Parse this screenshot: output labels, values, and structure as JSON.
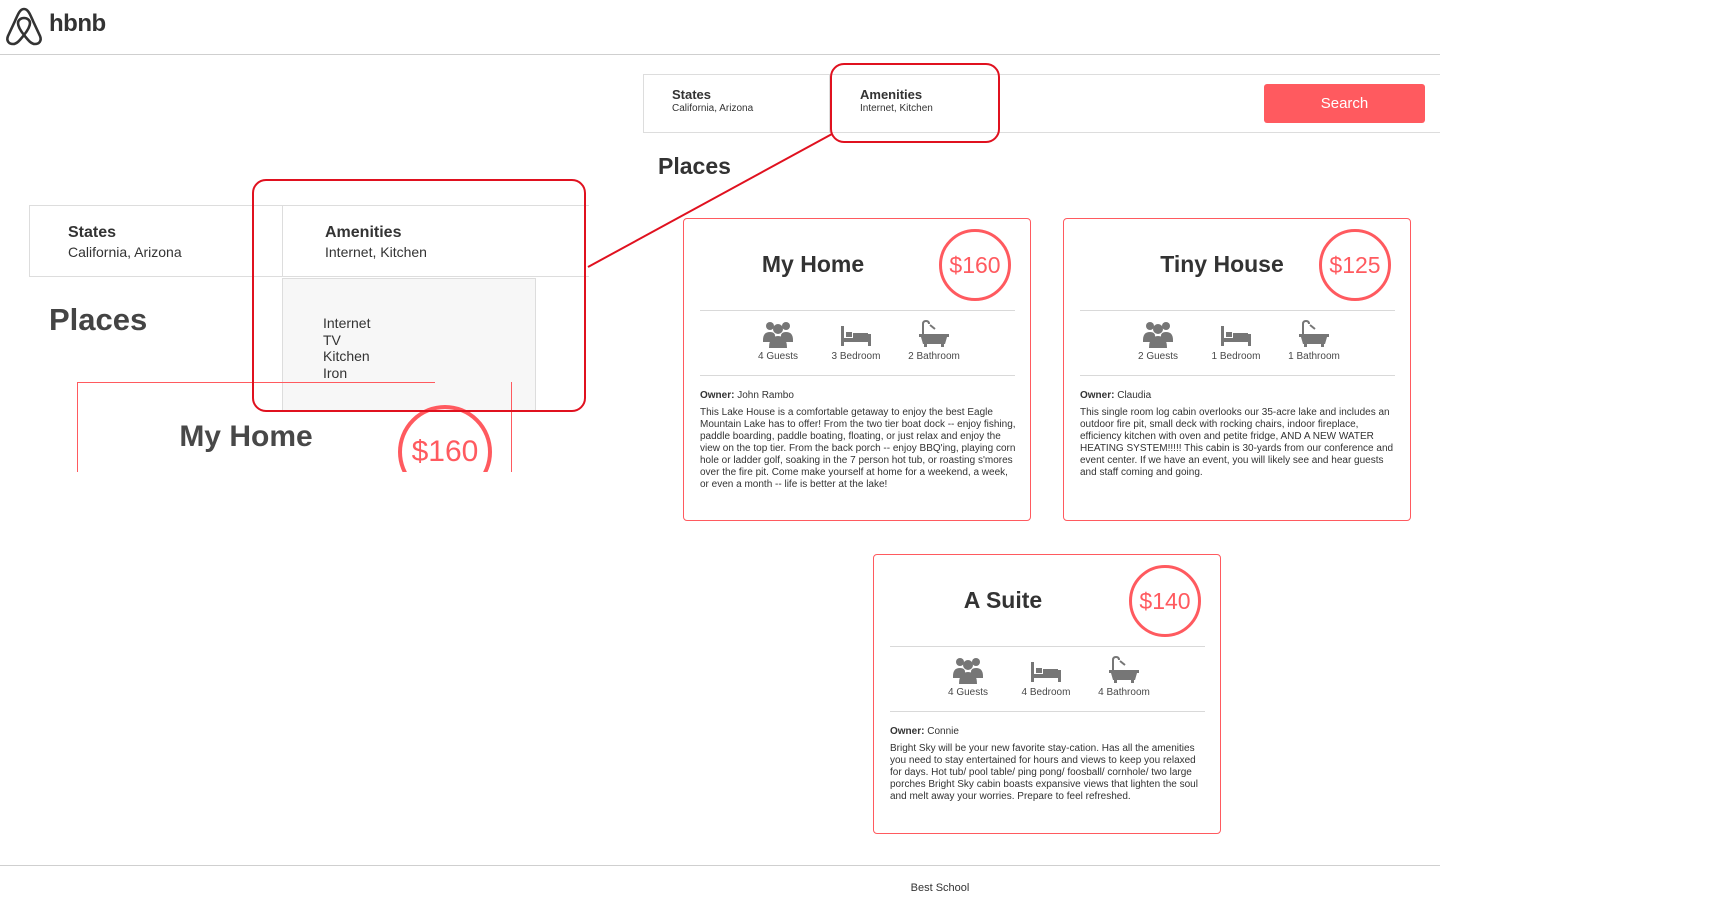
{
  "header": {
    "brand": "hbnb"
  },
  "filters": {
    "states_title": "States",
    "states_selected": "California, Arizona",
    "amenities_title": "Amenities",
    "amenities_selected": "Internet, Kitchen",
    "search_label": "Search"
  },
  "places_title": "Places",
  "amenities_dropdown": [
    "Internet",
    "TV",
    "Kitchen",
    "Iron"
  ],
  "places": [
    {
      "name": "My Home",
      "price": "$160",
      "guests": "4 Guests",
      "rooms": "3 Bedroom",
      "bathrooms": "2 Bathroom",
      "owner_label": "Owner:",
      "owner": "John Rambo",
      "description": "This Lake House is a comfortable getaway to enjoy the best Eagle Mountain Lake has to offer! From the two tier boat dock -- enjoy fishing, paddle boarding, paddle boating, floating, or just relax and enjoy the view on the top tier. From the back porch -- enjoy BBQ'ing, playing corn hole or ladder golf, soaking in the 7 person hot tub, or roasting s'mores over the fire pit. Come make yourself at home for a weekend, a week, or even a month -- life is better at the lake!"
    },
    {
      "name": "Tiny House",
      "price": "$125",
      "guests": "2 Guests",
      "rooms": "1 Bedroom",
      "bathrooms": "1 Bathroom",
      "owner_label": "Owner:",
      "owner": "Claudia",
      "description": "This single room log cabin overlooks our 35-acre lake and includes an outdoor fire pit, small deck with rocking chairs, indoor fireplace, efficiency kitchen with oven and petite fridge, AND A NEW WATER HEATING SYSTEM!!!!! This cabin is 30-yards from our conference and event center. If we have an event, you will likely see and hear guests and staff coming and going."
    },
    {
      "name": "A Suite",
      "price": "$140",
      "guests": "4 Guests",
      "rooms": "4 Bedroom",
      "bathrooms": "4 Bathroom",
      "owner_label": "Owner:",
      "owner": "Connie",
      "description": "Bright Sky will be your new favorite stay-cation. Has all the amenities you need to stay entertained for hours and views to keep you relaxed for days. Hot tub/ pool table/ ping pong/ foosball/ cornhole/ two large porches Bright Sky cabin boasts expansive views that lighten the soul and melt away your worries. Prepare to feel refreshed."
    }
  ],
  "footer": {
    "text": "Best School"
  },
  "colors": {
    "accent": "#ff5a5f",
    "highlight": "#e0111f",
    "text": "#484848"
  },
  "icons": [
    "airbnb-logo-icon",
    "guests-icon",
    "bed-icon",
    "bathtub-icon"
  ]
}
